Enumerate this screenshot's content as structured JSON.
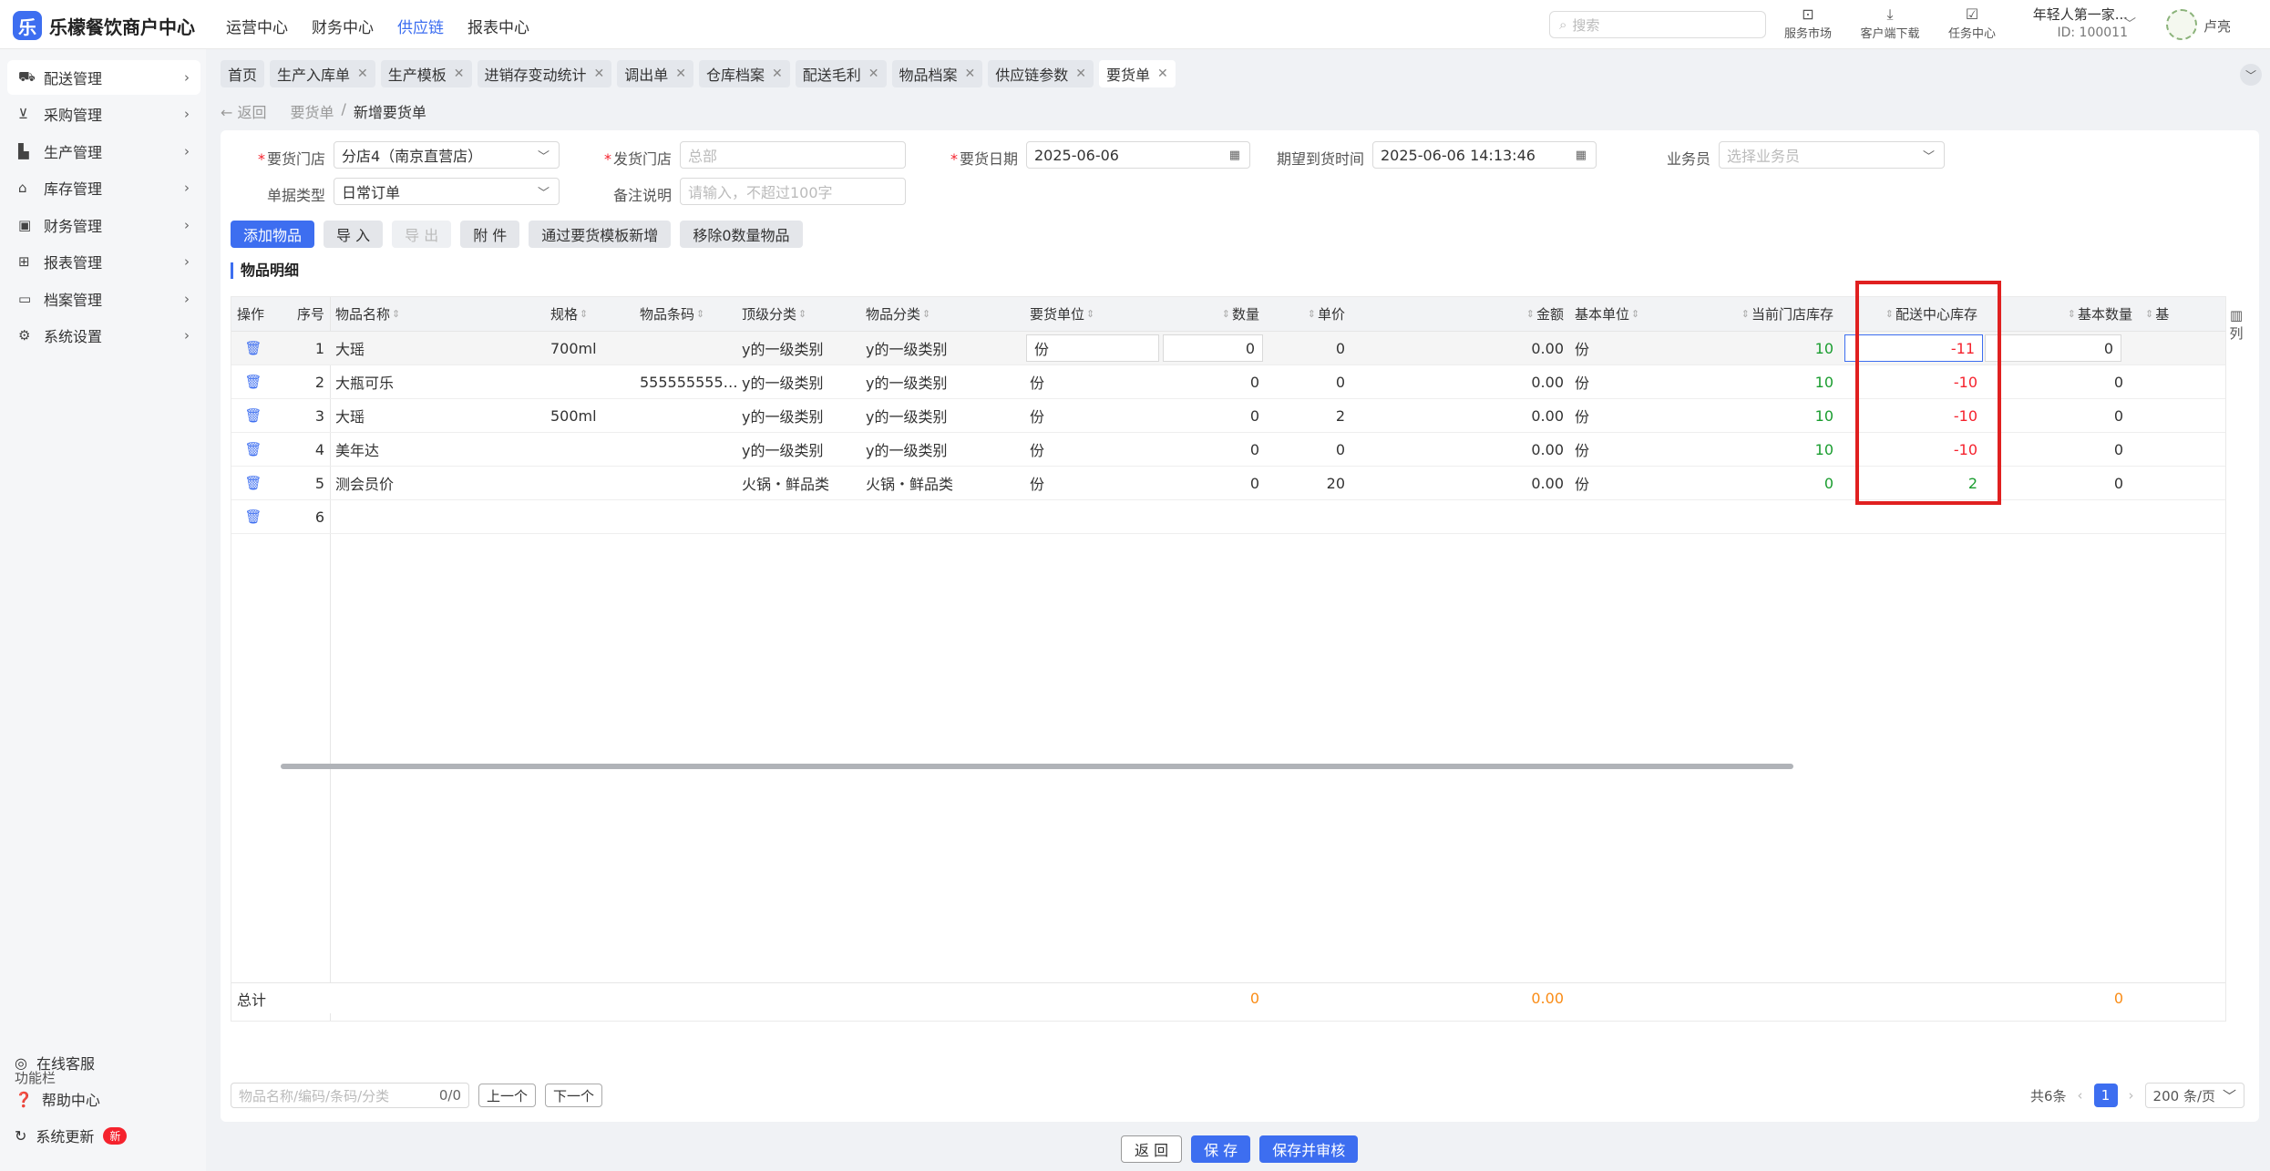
{
  "app": {
    "name": "乐檬餐饮商户中心",
    "logo_glyph": "乐"
  },
  "topnav": [
    {
      "label": "运营中心"
    },
    {
      "label": "财务中心"
    },
    {
      "label": "供应链",
      "active": true
    },
    {
      "label": "报表中心"
    }
  ],
  "search": {
    "placeholder": "搜索"
  },
  "top_icons": [
    {
      "label": "服务市场",
      "icon": "shop-icon"
    },
    {
      "label": "客户端下载",
      "icon": "download-icon"
    },
    {
      "label": "任务中心",
      "icon": "task-icon"
    }
  ],
  "user": {
    "org": "年轻人第一家...",
    "id": "ID: 100011",
    "name": "卢亮"
  },
  "sidebar": {
    "items": [
      {
        "label": "配送管理"
      },
      {
        "label": "采购管理"
      },
      {
        "label": "生产管理"
      },
      {
        "label": "库存管理"
      },
      {
        "label": "财务管理"
      },
      {
        "label": "报表管理"
      },
      {
        "label": "档案管理"
      },
      {
        "label": "系统设置"
      }
    ],
    "func_title": "功能栏",
    "func": [
      {
        "label": "在线客服"
      },
      {
        "label": "帮助中心"
      },
      {
        "label": "系统更新",
        "badge": "新"
      }
    ]
  },
  "tabs": [
    {
      "label": "首页"
    },
    {
      "label": "生产入库单"
    },
    {
      "label": "生产模板"
    },
    {
      "label": "进销存变动统计"
    },
    {
      "label": "调出单"
    },
    {
      "label": "仓库档案"
    },
    {
      "label": "配送毛利"
    },
    {
      "label": "物品档案"
    },
    {
      "label": "供应链参数"
    },
    {
      "label": "要货单"
    }
  ],
  "breadcrumb": {
    "back": "返回",
    "parent": "要货单",
    "sep": "/",
    "current": "新增要货单"
  },
  "form": {
    "store_label": "要货门店",
    "store_value": "分店4（南京直营店）",
    "ship_label": "发货门店",
    "ship_placeholder": "总部",
    "date_label": "要货日期",
    "date_value": "2025-06-06",
    "expect_label": "期望到货时间",
    "expect_value": "2025-06-06 14:13:46",
    "staff_label": "业务员",
    "staff_placeholder": "选择业务员",
    "type_label": "单据类型",
    "type_value": "日常订单",
    "remark_label": "备注说明",
    "remark_placeholder": "请输入，不超过100字"
  },
  "buttons": {
    "add": "添加物品",
    "import": "导 入",
    "export": "导 出",
    "attach": "附 件",
    "template": "通过要货模板新增",
    "remove_zero": "移除0数量物品"
  },
  "section_title": "物品明细",
  "table": {
    "headers": [
      "操作",
      "序号",
      "物品名称",
      "规格",
      "物品条码",
      "顶级分类",
      "物品分类",
      "要货单位",
      "数量",
      "单价",
      "金额",
      "基本单位",
      "当前门店库存",
      "配送中心库存",
      "基本数量",
      "基"
    ],
    "rows": [
      {
        "no": "1",
        "name": "大瑶",
        "spec": "700ml",
        "barcode": "",
        "top": "y的一级类别",
        "cat": "y的一级类别",
        "unit": "份",
        "qty": "0",
        "price": "0",
        "amount": "0.00",
        "base_unit": "份",
        "store_stock": "10",
        "dc_stock": "-11",
        "base_qty": "0"
      },
      {
        "no": "2",
        "name": "大瓶可乐",
        "spec": "",
        "barcode": "555555555…",
        "top": "y的一级类别",
        "cat": "y的一级类别",
        "unit": "份",
        "qty": "0",
        "price": "0",
        "amount": "0.00",
        "base_unit": "份",
        "store_stock": "10",
        "dc_stock": "-10",
        "base_qty": "0"
      },
      {
        "no": "3",
        "name": "大瑶",
        "spec": "500ml",
        "barcode": "",
        "top": "y的一级类别",
        "cat": "y的一级类别",
        "unit": "份",
        "qty": "0",
        "price": "2",
        "amount": "0.00",
        "base_unit": "份",
        "store_stock": "10",
        "dc_stock": "-10",
        "base_qty": "0"
      },
      {
        "no": "4",
        "name": "美年达",
        "spec": "",
        "barcode": "",
        "top": "y的一级类别",
        "cat": "y的一级类别",
        "unit": "份",
        "qty": "0",
        "price": "0",
        "amount": "0.00",
        "base_unit": "份",
        "store_stock": "10",
        "dc_stock": "-10",
        "base_qty": "0"
      },
      {
        "no": "5",
        "name": "测会员价",
        "spec": "",
        "barcode": "",
        "top": "火锅・鲜品类",
        "cat": "火锅・鲜品类",
        "unit": "份",
        "qty": "0",
        "price": "20",
        "amount": "0.00",
        "base_unit": "份",
        "store_stock": "0",
        "dc_stock": "2",
        "base_qty": "0"
      }
    ],
    "empty_row_no": "6",
    "total_label": "总计",
    "total_qty": "0",
    "total_amount": "0.00",
    "total_base_qty": "0",
    "colset_label": "列"
  },
  "pager": {
    "search_placeholder": "物品名称/编码/条码/分类",
    "count": "0/0",
    "prev": "上一个",
    "next": "下一个",
    "total": "共6条",
    "page": "1",
    "size": "200 条/页"
  },
  "footer": {
    "back": "返 回",
    "save": "保 存",
    "save_audit": "保存并审核"
  },
  "colors": {
    "accent": "#3d6ef0",
    "positive": "#1a9d2f",
    "negative": "#f5222d",
    "highlight": "#e02020"
  }
}
